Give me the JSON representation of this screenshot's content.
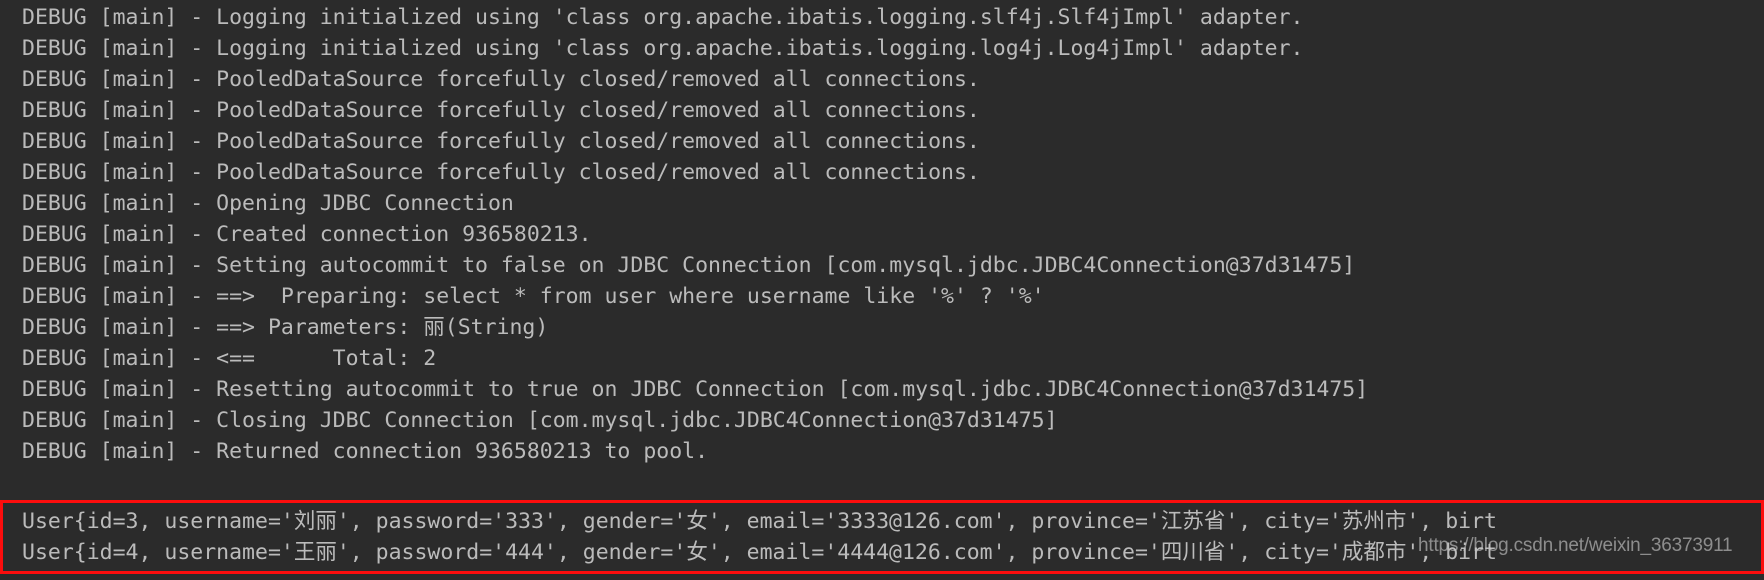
{
  "console": {
    "background_color": "#2b2b2b",
    "text_color": "#bbbbbb",
    "highlight_border_color": "#fc0d0d",
    "log_lines": [
      "DEBUG [main] - Logging initialized using 'class org.apache.ibatis.logging.slf4j.Slf4jImpl' adapter.",
      "DEBUG [main] - Logging initialized using 'class org.apache.ibatis.logging.log4j.Log4jImpl' adapter.",
      "DEBUG [main] - PooledDataSource forcefully closed/removed all connections.",
      "DEBUG [main] - PooledDataSource forcefully closed/removed all connections.",
      "DEBUG [main] - PooledDataSource forcefully closed/removed all connections.",
      "DEBUG [main] - PooledDataSource forcefully closed/removed all connections.",
      "DEBUG [main] - Opening JDBC Connection",
      "DEBUG [main] - Created connection 936580213.",
      "DEBUG [main] - Setting autocommit to false on JDBC Connection [com.mysql.jdbc.JDBC4Connection@37d31475]",
      "DEBUG [main] - ==>  Preparing: select * from user where username like '%' ? '%'",
      "DEBUG [main] - ==> Parameters: 丽(String)",
      "DEBUG [main] - <==      Total: 2",
      "DEBUG [main] - Resetting autocommit to true on JDBC Connection [com.mysql.jdbc.JDBC4Connection@37d31475]",
      "DEBUG [main] - Closing JDBC Connection [com.mysql.jdbc.JDBC4Connection@37d31475]",
      "DEBUG [main] - Returned connection 936580213 to pool."
    ],
    "result_lines": [
      "User{id=3, username='刘丽', password='333', gender='女', email='3333@126.com', province='江苏省', city='苏州市', birt",
      "User{id=4, username='王丽', password='444', gender='女', email='4444@126.com', province='四川省', city='成都市', birt"
    ],
    "watermark": "https://blog.csdn.net/weixin_36373911"
  }
}
